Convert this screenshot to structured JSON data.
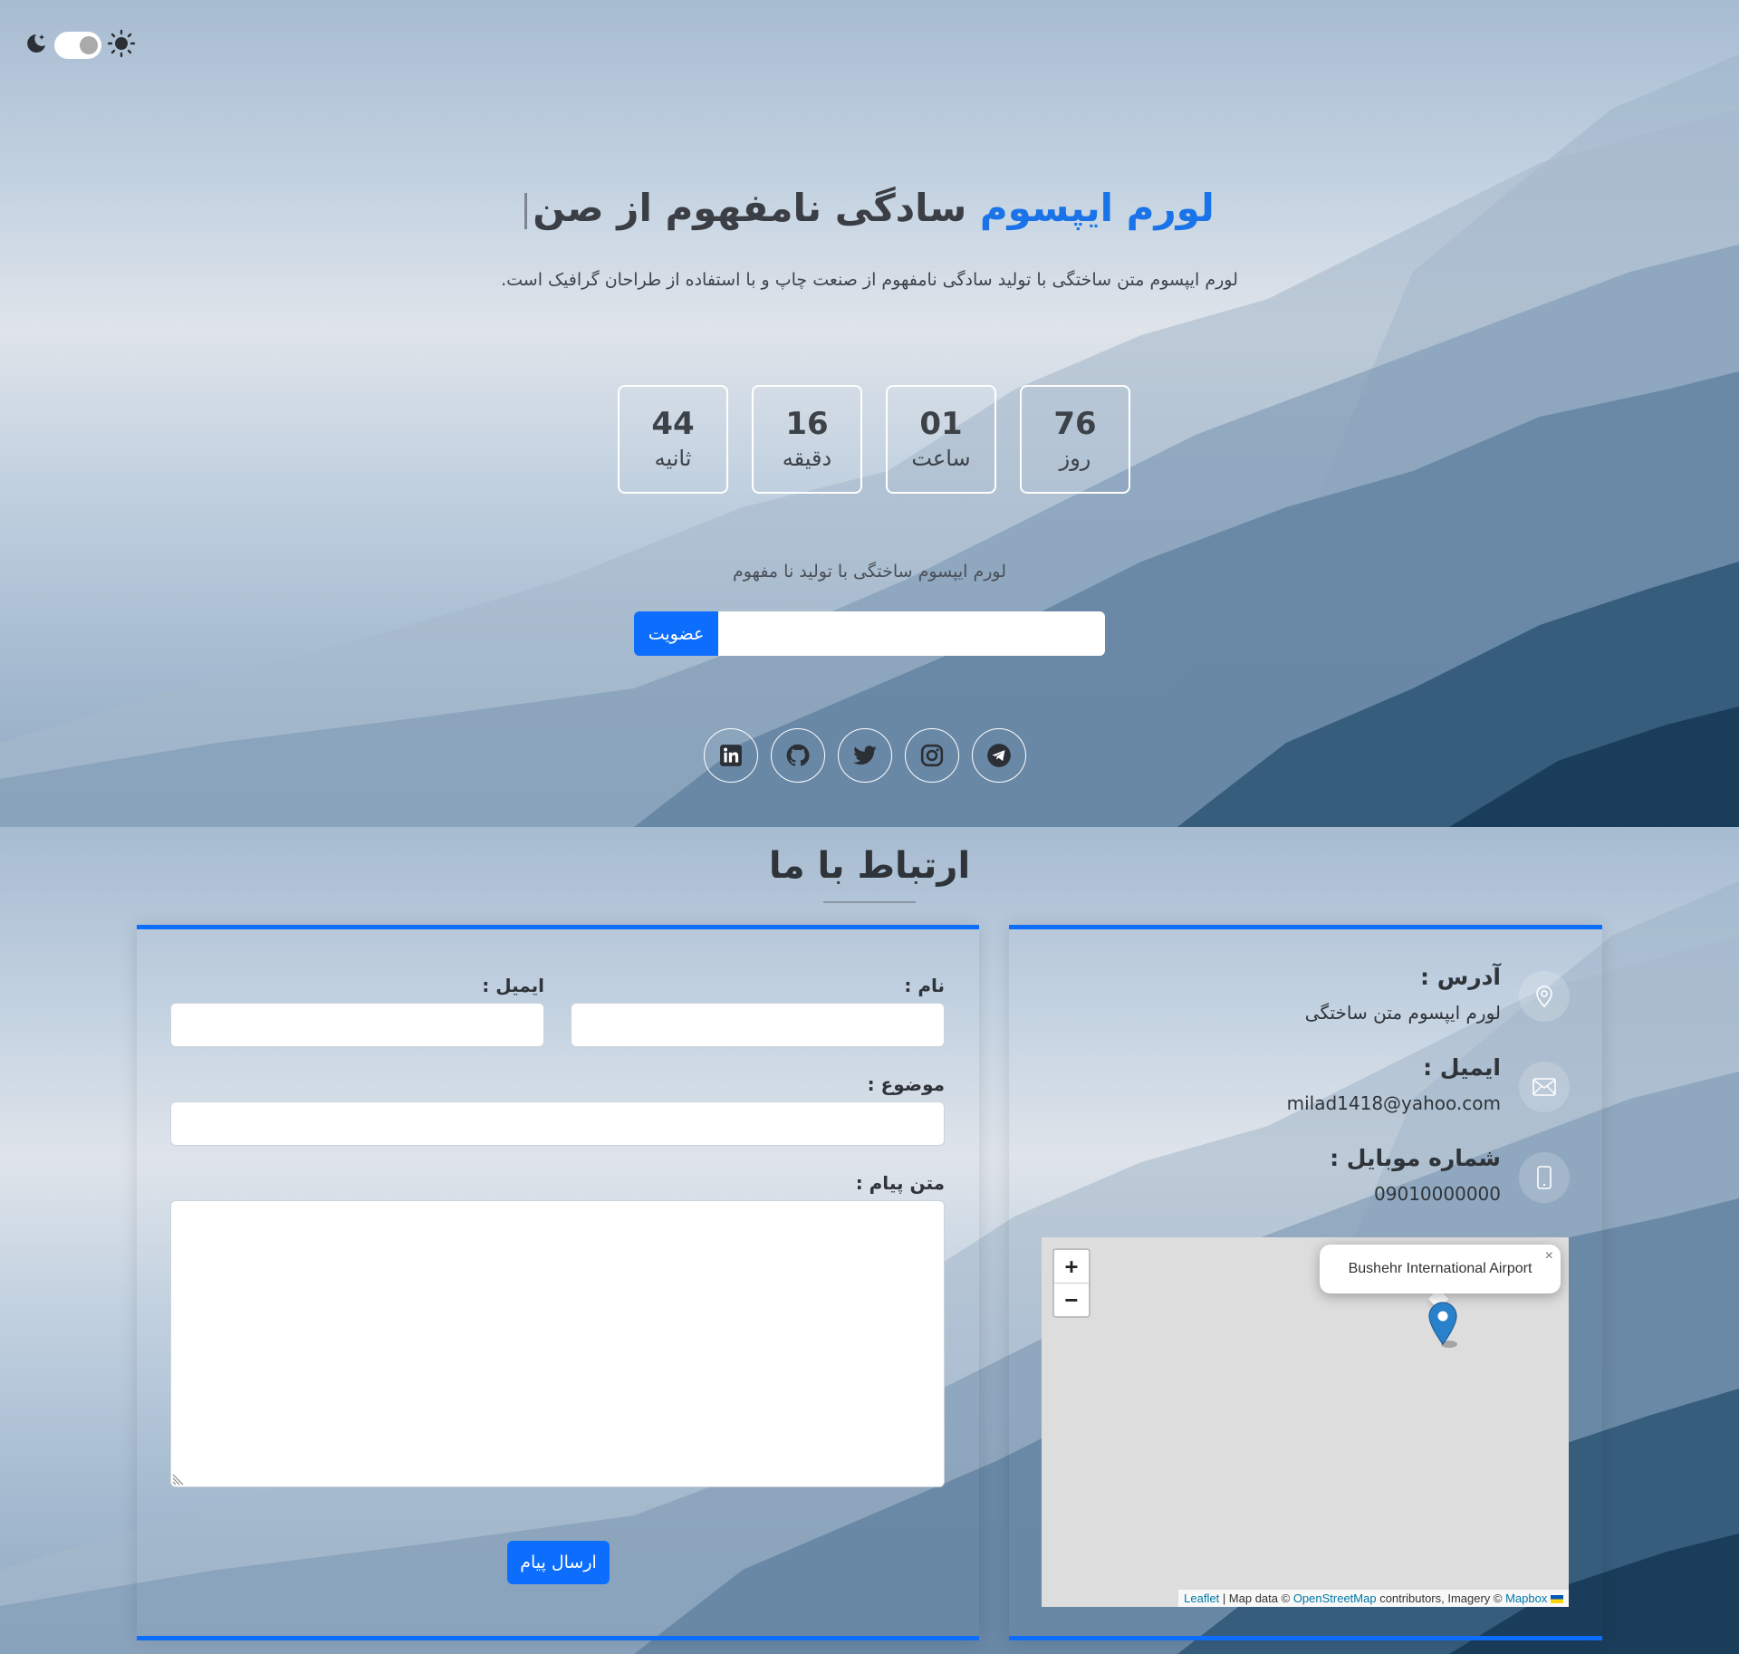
{
  "colors": {
    "accent": "#0d6efd",
    "title_accent": "#1a73e8",
    "text": "#2f343a"
  },
  "theme_toggle": {
    "moon_icon": "moon-stars-icon",
    "sun_icon": "sun-icon",
    "state": "light"
  },
  "hero": {
    "title_accent": "لورم ایپسوم",
    "title_rest": " سادگی نامفهوم از صن",
    "subtitle": "لورم ایپسوم متن ساختگی با تولید سادگی نامفهوم از صنعت چاپ و با استفاده از طراحان گرافیک است.",
    "countdown": [
      {
        "value": "76",
        "label": "روز"
      },
      {
        "value": "01",
        "label": "ساعت"
      },
      {
        "value": "16",
        "label": "دقیقه"
      },
      {
        "value": "44",
        "label": "ثانیه"
      }
    ],
    "caption": "لورم ایپسوم ساختگی با تولید نا مفهوم",
    "subscribe": {
      "button": "عضویت",
      "placeholder": ""
    },
    "socials": [
      "linkedin-icon",
      "github-icon",
      "twitter-icon",
      "instagram-icon",
      "telegram-icon"
    ]
  },
  "contact": {
    "title": "ارتباط با ما",
    "form": {
      "name_label": "نام :",
      "email_label": "ایمیل :",
      "subject_label": "موضوع :",
      "message_label": "متن پیام :",
      "submit": "ارسال پیام"
    },
    "info": {
      "address_title": "آدرس :",
      "address_value": "لورم ایپسوم متن ساختگی",
      "email_title": "ایمیل :",
      "email_value": "milad1418@yahoo.com",
      "phone_title": "شماره موبایل :",
      "phone_value": "09010000000"
    },
    "map": {
      "zoom_in": "+",
      "zoom_out": "−",
      "popup": "Bushehr International Airport",
      "popup_close": "×",
      "attribution": {
        "leaflet": "Leaflet",
        "sep": " | Map data © ",
        "osm": "OpenStreetMap",
        "mid": " contributors, Imagery © ",
        "mapbox": "Mapbox"
      }
    }
  }
}
